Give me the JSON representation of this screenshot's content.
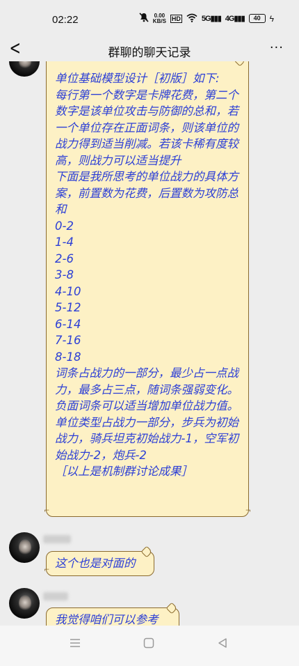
{
  "status_bar": {
    "time": "02:22",
    "net_speed_value": "0.00",
    "net_speed_unit": "KB/S",
    "hd_label": "HD",
    "signal_1": "5G",
    "signal_2": "4G",
    "battery": "40"
  },
  "header": {
    "title": "群聊的聊天记录",
    "back_icon": "chevron-left-icon",
    "more_icon": "ellipsis-icon"
  },
  "messages": [
    {
      "text": "单位基础模型设计［初版］如下:\n每行第一个数字是卡牌花费，第二个数字是该单位攻击与防御的总和，若一个单位存在正面词条，则该单位的战力得到适当削减。若该卡稀有度较高，则战力可以适当提升\n下面是我所思考的单位战力的具体方案，前置数为花费，后置数为攻防总和\n0-2\n1-4\n2-6\n3-8\n4-10\n5-12\n6-14\n7-16\n8-18\n词条占战力的一部分，最少占一点战力，最多占三点，随词条强弱变化。负面词条可以适当增加单位战力值。\n单位类型占战力一部分，步兵为初始战力，骑兵坦克初始战力-1，空军初始战力-2，炮兵-2\n［以上是机制群讨论成果］"
    },
    {
      "text": "这个也是对面的"
    },
    {
      "text": "我觉得咱们可以参考"
    }
  ],
  "nav_bar": {
    "menu_icon": "menu-icon",
    "home_icon": "home-icon",
    "back_icon": "back-triangle-icon"
  }
}
